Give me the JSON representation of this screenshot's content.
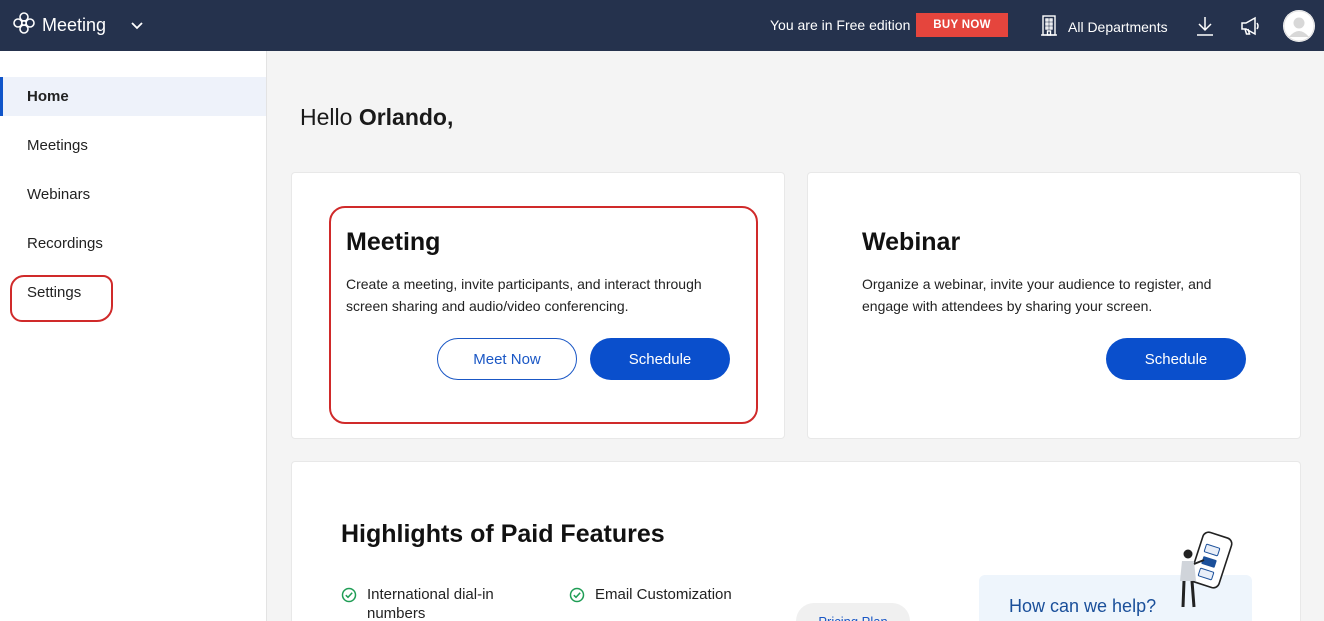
{
  "app": {
    "title": "Meeting",
    "edition_text": "You are in Free edition",
    "buy_label": "BUY NOW",
    "department": "All Departments"
  },
  "colors": {
    "topbar": "#25324d",
    "buy": "#e5453d",
    "primary": "#0a4fcc",
    "highlight_annotation": "#d02a2a"
  },
  "icons": {
    "brand": "flower-logo-icon",
    "chevron": "chevron-down-icon",
    "department": "building-icon",
    "download": "download-icon",
    "announce": "megaphone-icon",
    "avatar": "avatar"
  },
  "sidebar": {
    "items": [
      {
        "label": "Home",
        "active": true
      },
      {
        "label": "Meetings",
        "active": false
      },
      {
        "label": "Webinars",
        "active": false
      },
      {
        "label": "Recordings",
        "active": false
      },
      {
        "label": "Settings",
        "active": false
      }
    ]
  },
  "main": {
    "greeting_prefix": "Hello",
    "user_name": "Orlando,",
    "meeting_card": {
      "title": "Meeting",
      "description": "Create a meeting, invite participants, and interact through screen sharing and audio/video conferencing.",
      "meet_now_label": "Meet Now",
      "schedule_label": "Schedule"
    },
    "webinar_card": {
      "title": "Webinar",
      "description": "Organize a webinar, invite your audience to register, and engage with attendees by sharing your screen.",
      "schedule_label": "Schedule"
    },
    "highlights": {
      "title": "Highlights of Paid Features",
      "features": [
        "International dial-in numbers",
        "Email Customization"
      ],
      "pricing_label": "Pricing Plan"
    },
    "help": {
      "text": "How can we help?"
    }
  }
}
